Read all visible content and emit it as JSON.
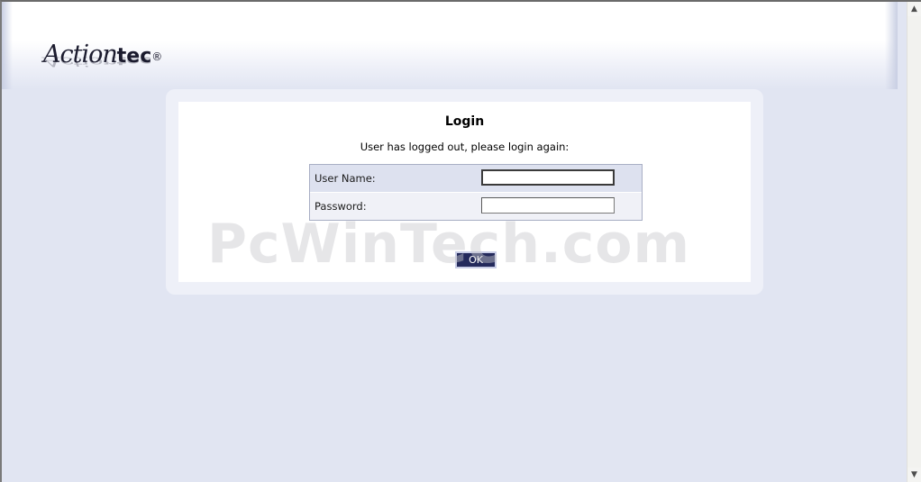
{
  "header": {
    "logo_script": "Action",
    "logo_bold": "tec",
    "logo_reg": "®"
  },
  "login": {
    "title": "Login",
    "message": "User has logged out, please login again:",
    "username_label": "User Name:",
    "username_value": "",
    "password_label": "Password:",
    "password_value": "",
    "ok_label": "OK"
  },
  "watermark": "PcWinTech.com",
  "scrollbar": {
    "up_icon": "▲",
    "down_icon": "▼"
  },
  "colors": {
    "page_background": "#e1e5f2",
    "button_background": "#242a5c"
  }
}
